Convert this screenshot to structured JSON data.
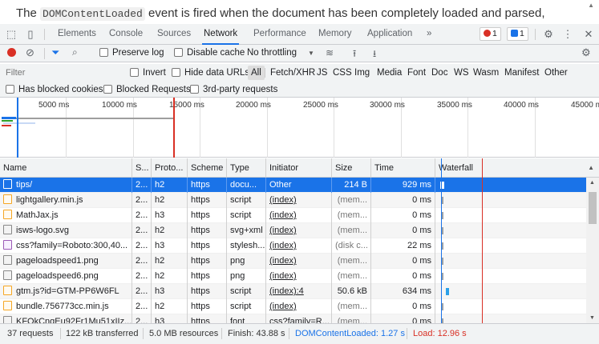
{
  "page_text": {
    "prefix": "The ",
    "code": "DOMContentLoaded",
    "suffix": " event is fired when the document has been completely loaded and parsed,"
  },
  "devtools": {
    "tabs": [
      "Elements",
      "Console",
      "Sources",
      "Network",
      "Performance",
      "Memory",
      "Application"
    ],
    "active_tab": "Network",
    "more_tabs": "»",
    "error_count": "1",
    "message_count": "1"
  },
  "toolbar": {
    "preserve_log": "Preserve log",
    "disable_cache": "Disable cache",
    "throttling": "No throttling"
  },
  "filter": {
    "placeholder": "Filter",
    "invert": "Invert",
    "hide_data_urls": "Hide data URLs",
    "types": [
      "All",
      "Fetch/XHR",
      "JS",
      "CSS",
      "Img",
      "Media",
      "Font",
      "Doc",
      "WS",
      "Wasm",
      "Manifest",
      "Other"
    ],
    "has_blocked_cookies": "Has blocked cookies",
    "blocked_requests": "Blocked Requests",
    "third_party": "3rd-party requests"
  },
  "overview": {
    "ticks": [
      "5000 ms",
      "10000 ms",
      "15000 ms",
      "20000 ms",
      "25000 ms",
      "30000 ms",
      "35000 ms",
      "40000 ms",
      "45000 m"
    ]
  },
  "table": {
    "columns": [
      "Name",
      "S...",
      "Proto...",
      "Scheme",
      "Type",
      "Initiator",
      "Size",
      "Time",
      "Waterfall"
    ],
    "rows": [
      {
        "name": "tips/",
        "status": "2...",
        "protocol": "h2",
        "scheme": "https",
        "type": "docu...",
        "initiator": "Other",
        "size": "214 B",
        "time": "929 ms",
        "icon": "doc"
      },
      {
        "name": "lightgallery.min.js",
        "status": "2...",
        "protocol": "h2",
        "scheme": "https",
        "type": "script",
        "initiator": "(index)",
        "size": "(mem...",
        "time": "0 ms",
        "icon": "js"
      },
      {
        "name": "MathJax.js",
        "status": "2...",
        "protocol": "h3",
        "scheme": "https",
        "type": "script",
        "initiator": "(index)",
        "size": "(mem...",
        "time": "0 ms",
        "icon": "js"
      },
      {
        "name": "isws-logo.svg",
        "status": "2...",
        "protocol": "h2",
        "scheme": "https",
        "type": "svg+xml",
        "initiator": "(index)",
        "size": "(mem...",
        "time": "0 ms",
        "icon": "img"
      },
      {
        "name": "css?family=Roboto:300,40...",
        "status": "2...",
        "protocol": "h3",
        "scheme": "https",
        "type": "stylesh...",
        "initiator": "(index)",
        "size": "(disk c...",
        "time": "22 ms",
        "icon": "css"
      },
      {
        "name": "pageloadspeed1.png",
        "status": "2...",
        "protocol": "h2",
        "scheme": "https",
        "type": "png",
        "initiator": "(index)",
        "size": "(mem...",
        "time": "0 ms",
        "icon": "img"
      },
      {
        "name": "pageloadspeed6.png",
        "status": "2...",
        "protocol": "h2",
        "scheme": "https",
        "type": "png",
        "initiator": "(index)",
        "size": "(mem...",
        "time": "0 ms",
        "icon": "img"
      },
      {
        "name": "gtm.js?id=GTM-PP6W6FL",
        "status": "2...",
        "protocol": "h3",
        "scheme": "https",
        "type": "script",
        "initiator": "(index):4",
        "size": "50.6 kB",
        "time": "634 ms",
        "icon": "js"
      },
      {
        "name": "bundle.756773cc.min.js",
        "status": "2...",
        "protocol": "h2",
        "scheme": "https",
        "type": "script",
        "initiator": "(index)",
        "size": "(mem...",
        "time": "0 ms",
        "icon": "js"
      },
      {
        "name": "KFOkCnqEu92Fr1Mu51xIIz...",
        "status": "2...",
        "protocol": "h3",
        "scheme": "https",
        "type": "font",
        "initiator": "css?family=R...",
        "size": "(mem...",
        "time": "0 ms",
        "icon": "img"
      }
    ]
  },
  "status": {
    "requests": "37 requests",
    "transferred": "122 kB transferred",
    "resources": "5.0 MB resources",
    "finish": "Finish: 43.88 s",
    "dom_loaded": "DOMContentLoaded: 1.27 s",
    "load": "Load: 12.96 s"
  },
  "colors": {
    "accent": "#1a73e8",
    "dom_line": "#1a73e8",
    "load_line": "#d93025",
    "error": "#d93025"
  }
}
